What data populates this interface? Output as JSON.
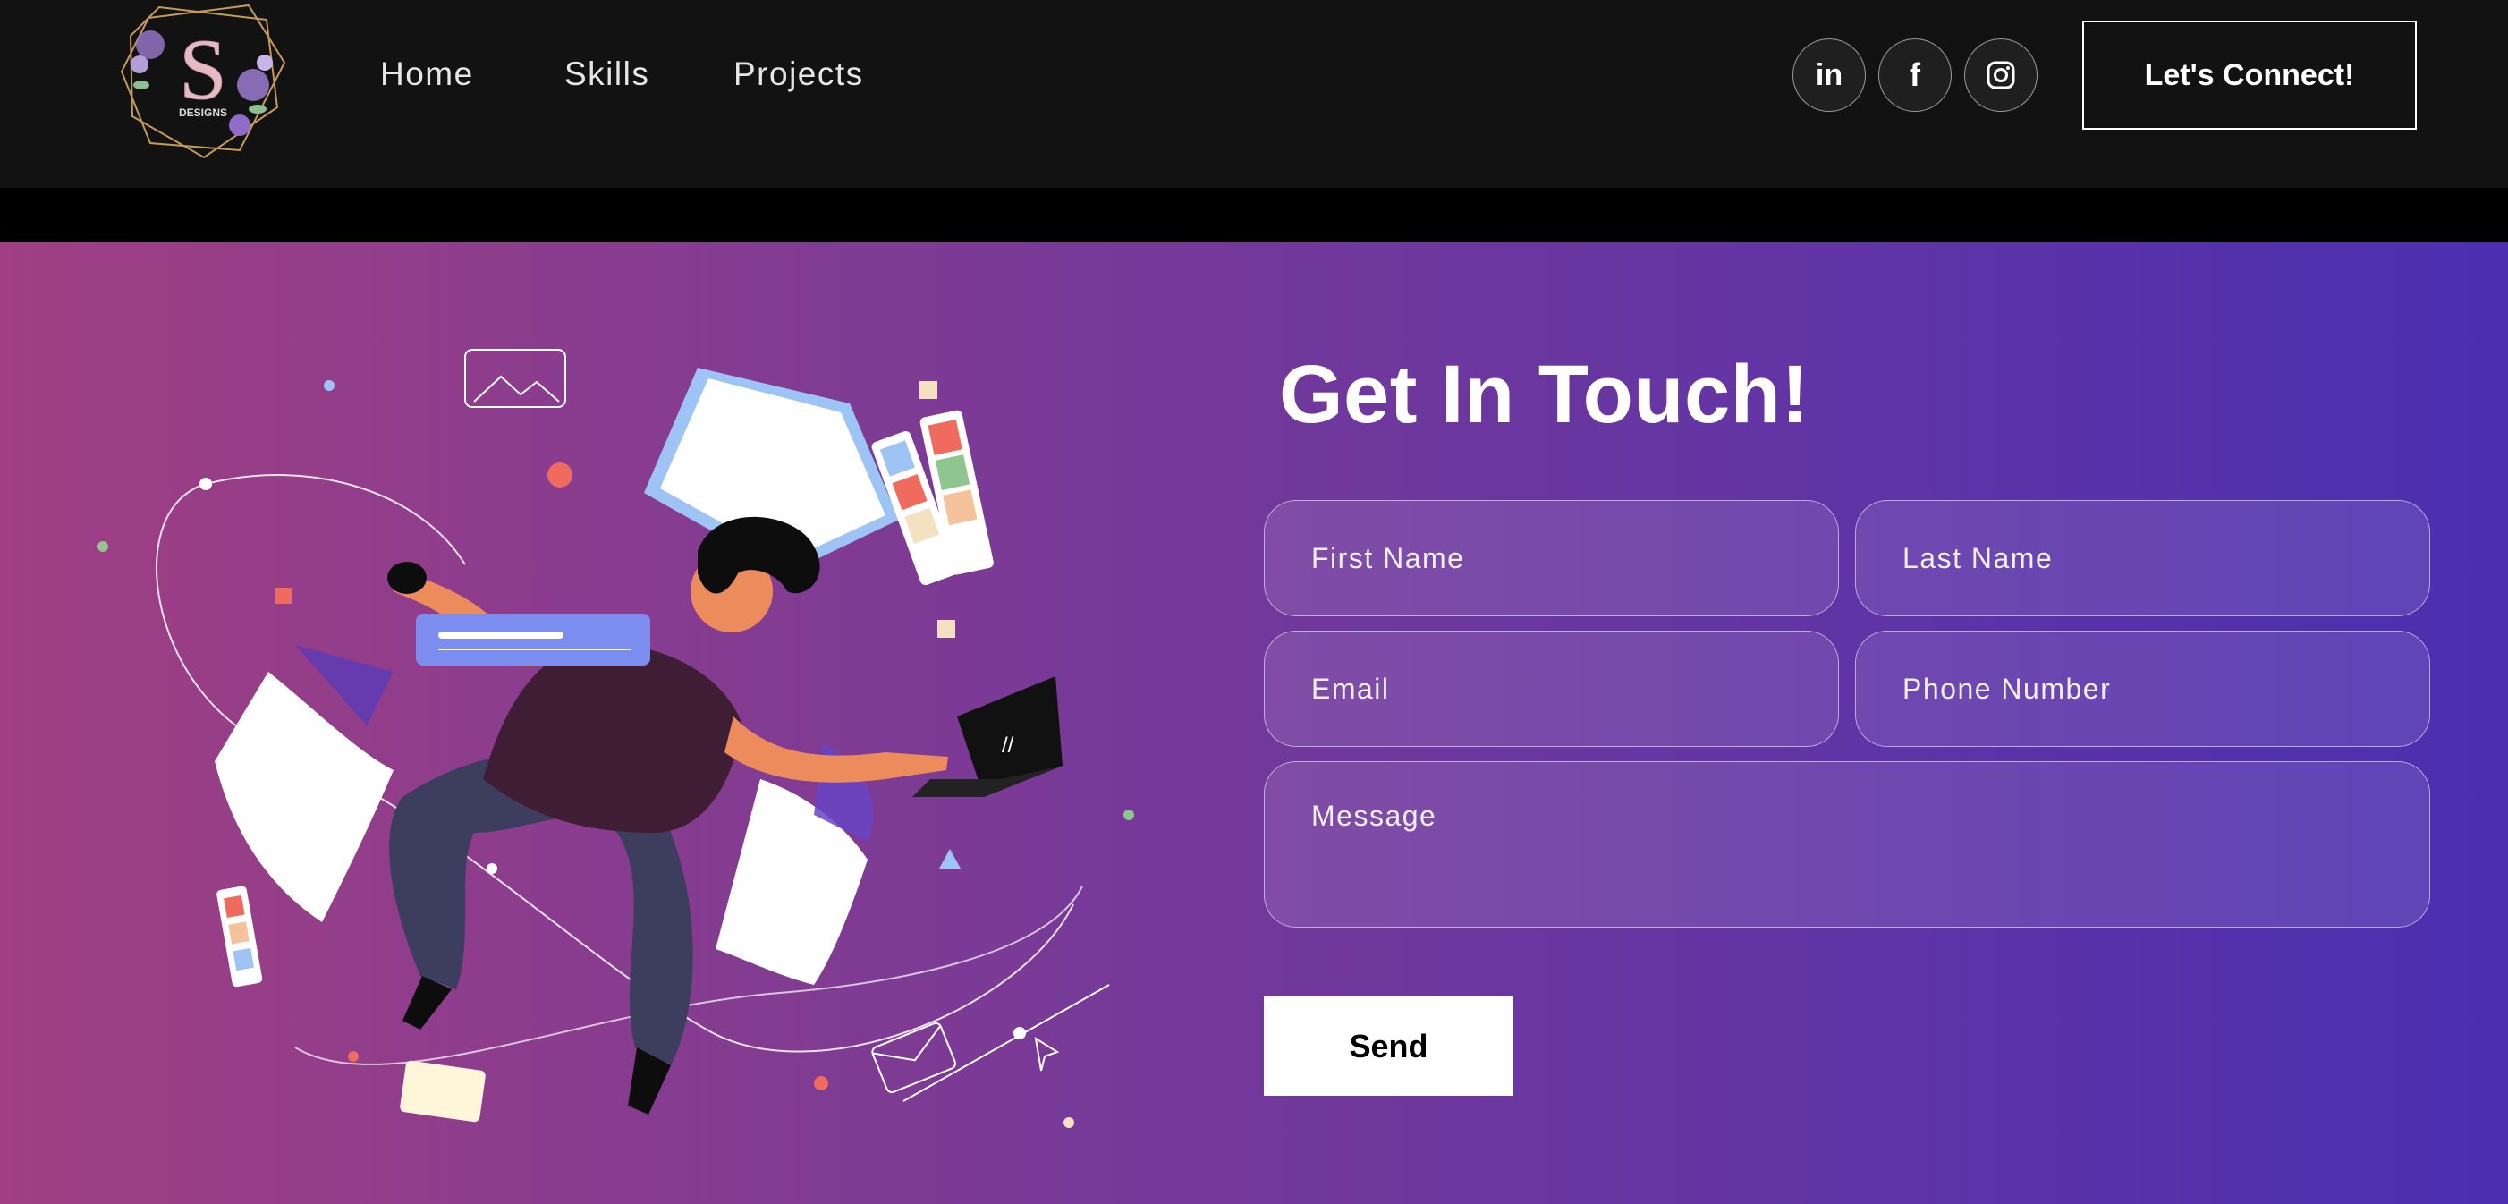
{
  "brand": {
    "logo_text": "DESIGNS",
    "logo_letter": "S"
  },
  "nav": {
    "items": [
      {
        "label": "Home"
      },
      {
        "label": "Skills"
      },
      {
        "label": "Projects"
      }
    ]
  },
  "social": [
    {
      "icon": "linkedin-icon",
      "glyph": "in"
    },
    {
      "icon": "facebook-icon",
      "glyph": "f"
    },
    {
      "icon": "instagram-icon",
      "glyph": ""
    }
  ],
  "header": {
    "connect_label": "Let's Connect!"
  },
  "contact": {
    "heading": "Get In Touch!",
    "fields": {
      "first_name": {
        "placeholder": "First Name",
        "value": ""
      },
      "last_name": {
        "placeholder": "Last Name",
        "value": ""
      },
      "email": {
        "placeholder": "Email",
        "value": ""
      },
      "phone": {
        "placeholder": "Phone Number",
        "value": ""
      },
      "message": {
        "placeholder": "Message",
        "value": ""
      }
    },
    "send_label": "Send"
  },
  "colors": {
    "nav_bg": "#121212",
    "gradient_start": "#a03f83",
    "gradient_end": "#4b2fb0",
    "button_bg": "#ffffff"
  }
}
